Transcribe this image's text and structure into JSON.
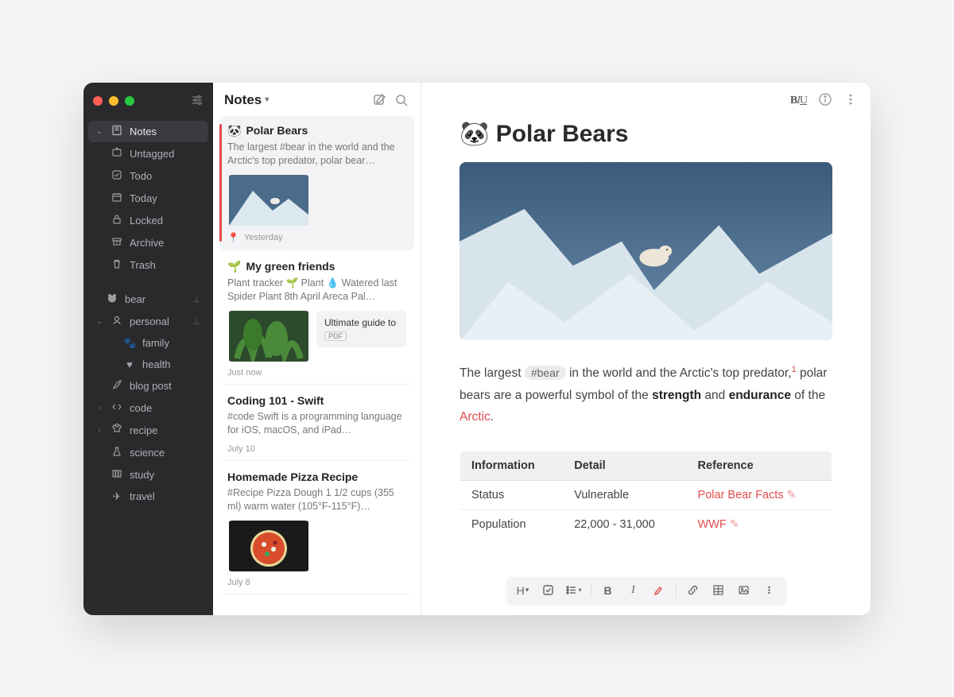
{
  "sidebar": {
    "notes": "Notes",
    "untagged": "Untagged",
    "todo": "Todo",
    "today": "Today",
    "locked": "Locked",
    "archive": "Archive",
    "trash": "Trash",
    "tags": {
      "bear": "bear",
      "personal": "personal",
      "family": "family",
      "health": "health",
      "blogpost": "blog post",
      "code": "code",
      "recipe": "recipe",
      "science": "science",
      "study": "study",
      "travel": "travel"
    }
  },
  "notelist": {
    "title": "Notes",
    "items": [
      {
        "emoji": "🐼",
        "title": "Polar Bears",
        "preview": "The largest #bear in the world and the Arctic's top predator, polar bear…",
        "date": "Yesterday",
        "pinned": true
      },
      {
        "emoji": "🌱",
        "title": "My green friends",
        "preview": "Plant tracker 🌱 Plant 💧 Watered last Spider Plant 8th April Areca Pal…",
        "attachment_title": "Ultimate guide to",
        "attachment_badge": "PDF",
        "date": "Just now"
      },
      {
        "title": "Coding 101 - Swift",
        "preview": "#code Swift is a programming language for iOS, macOS, and iPad…",
        "date": "July 10"
      },
      {
        "title": "Homemade Pizza Recipe",
        "preview": "#Recipe Pizza Dough 1 1/2 cups (355 ml) warm water (105°F-115°F)…",
        "date": "July 8"
      }
    ]
  },
  "editor": {
    "title_emoji": "🐼",
    "title": "Polar Bears",
    "para_prefix": "The largest ",
    "hashtag": "#bear",
    "para_mid1": " in the world and the Arctic's top predator,",
    "sup": "1",
    "para_mid2": " polar bears are a powerful symbol of the ",
    "strong1": "strength",
    "para_mid3": " and ",
    "strong2": "endurance",
    "para_mid4": " of the ",
    "arctic": "Arctic",
    "para_end": ".",
    "table": {
      "headers": [
        "Information",
        "Detail",
        "Reference"
      ],
      "rows": [
        {
          "info": "Status",
          "detail": "Vulnerable",
          "ref": "Polar Bear Facts"
        },
        {
          "info": "Population",
          "detail": "22,000 - 31,000",
          "ref": "WWF"
        }
      ]
    }
  },
  "bottom_toolbar": {
    "heading": "H",
    "bold": "B",
    "italic": "I"
  },
  "top_toolbar": {
    "biui": "BIU"
  }
}
